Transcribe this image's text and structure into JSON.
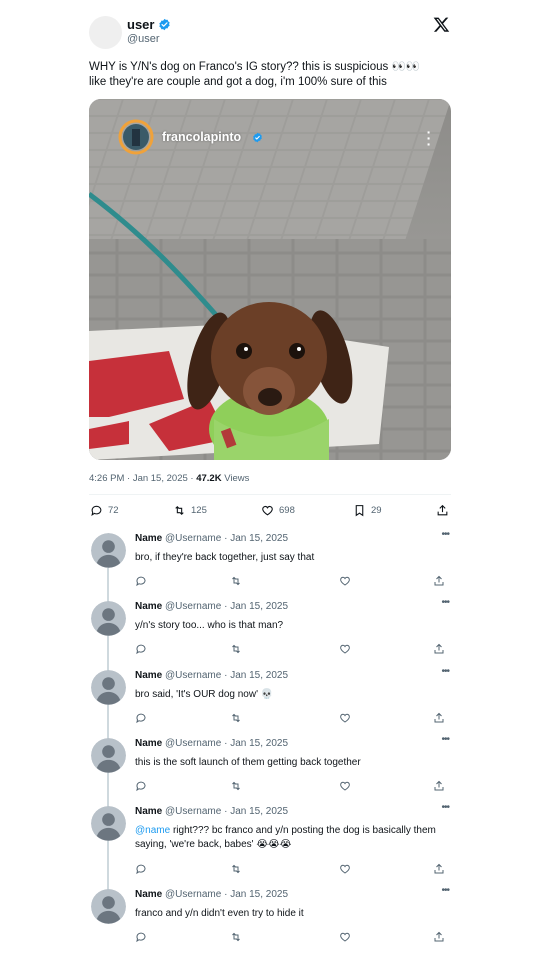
{
  "post": {
    "display_name": "user",
    "handle": "@user",
    "text_line1": "WHY is Y/N's dog on Franco's IG story?? this is suspicious 👀👀",
    "text_line2": "like they're are couple and got a dog, i'm 100% sure of this",
    "story_username": "francolapinto",
    "time": "4:26 PM · Jan 15, 2025 · ",
    "views_count": "47.2K",
    "views_label": " Views",
    "replies": "72",
    "reposts": "125",
    "likes": "698",
    "bookmarks": "29"
  },
  "comments": [
    {
      "name": "Name",
      "handle": "@Username · Jan 15, 2025",
      "mention": "",
      "text": "bro, if they're back together, just say that"
    },
    {
      "name": "Name",
      "handle": "@Username · Jan 15, 2025",
      "mention": "",
      "text": "y/n's story too... who is that man?"
    },
    {
      "name": "Name",
      "handle": "@Username · Jan 15, 2025",
      "mention": "",
      "text": "bro said, 'It's OUR dog now' 💀"
    },
    {
      "name": "Name",
      "handle": "@Username · Jan 15, 2025",
      "mention": "",
      "text": "this is the soft launch of them getting back together"
    },
    {
      "name": "Name",
      "handle": "@Username · Jan 15, 2025",
      "mention": "@name",
      "text": " right??? bc franco and y/n posting the dog is basically them saying, 'we're back, babes' 😭😭😭"
    },
    {
      "name": "Name",
      "handle": "@Username · Jan 15, 2025",
      "mention": "",
      "text": "franco and y/n didn't even try to hide it"
    }
  ],
  "colors": {
    "verified": "#1d9bf0",
    "muted": "#536471",
    "mention": "#1d9bf0",
    "avatar_gray": "#b8c1c9"
  },
  "icons": [
    "x-logo-icon",
    "verified-badge-icon",
    "reply-icon",
    "repost-icon",
    "like-icon",
    "bookmark-icon",
    "share-icon",
    "more-icon"
  ]
}
